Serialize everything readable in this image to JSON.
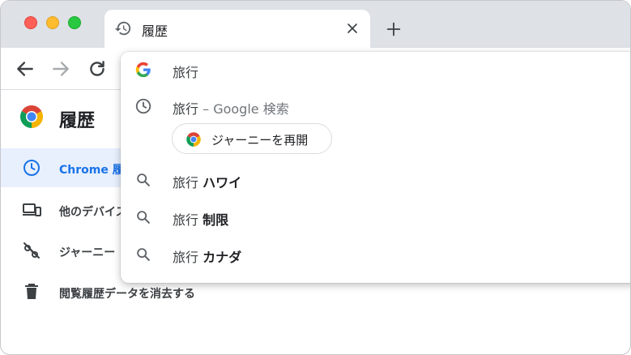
{
  "tab": {
    "title": "履歴"
  },
  "page": {
    "title": "履歴"
  },
  "sidebar": {
    "items": [
      {
        "label": "Chrome 履歴"
      },
      {
        "label": "他のデバイス"
      },
      {
        "label": "ジャーニー"
      },
      {
        "label": "閲覧履歴データを消去する"
      }
    ]
  },
  "suggestions": {
    "first": {
      "query": "旅行"
    },
    "history": {
      "query": "旅行",
      "separator": " – ",
      "suffix": "Google 検索"
    },
    "journey_chip": {
      "label": "ジャーニーを再開"
    },
    "items": [
      {
        "prefix": "旅行 ",
        "bold": "ハワイ"
      },
      {
        "prefix": "旅行 ",
        "bold": "制限"
      },
      {
        "prefix": "旅行 ",
        "bold": "カナダ"
      }
    ]
  },
  "colors": {
    "accent": "#1a73e8",
    "tabbar": "#dee1e6"
  }
}
